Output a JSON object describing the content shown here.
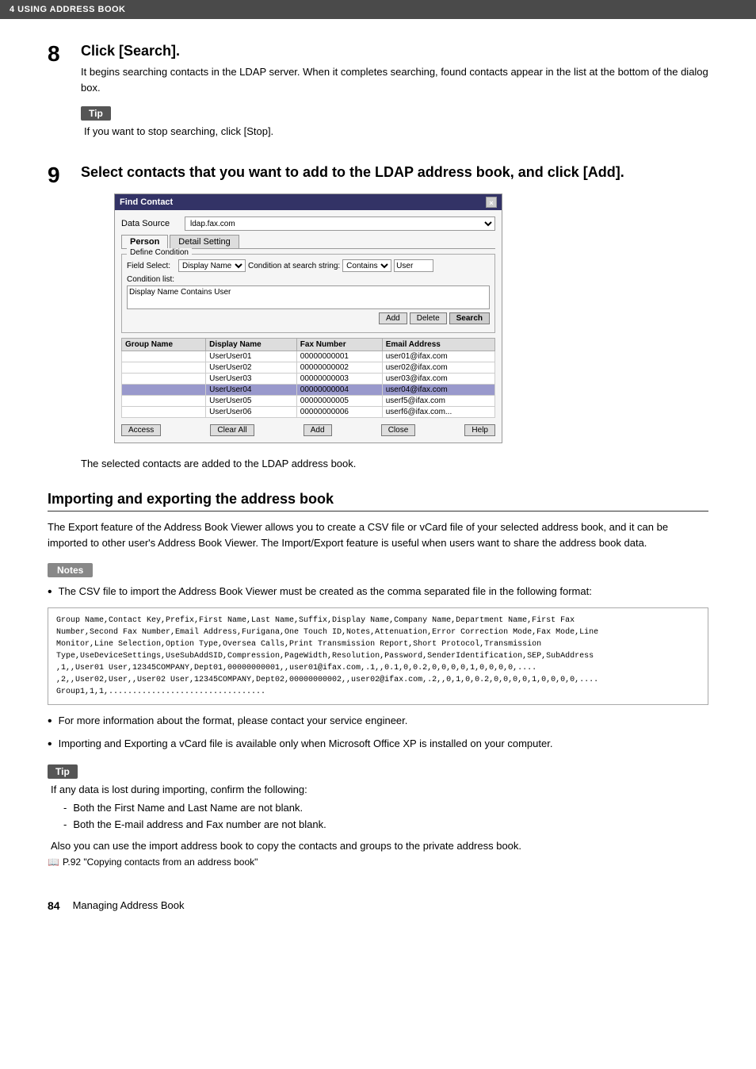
{
  "header": {
    "text": "4   USING ADDRESS BOOK"
  },
  "step8": {
    "number": "8",
    "title": "Click [Search].",
    "description": "It begins searching contacts in the LDAP server. When it completes searching, found contacts appear in the list at the bottom of the dialog box."
  },
  "tip1": {
    "label": "Tip",
    "text": "If you want to stop searching, click [Stop]."
  },
  "step9": {
    "number": "9",
    "title": "Select contacts that you want to add to the LDAP address book, and click [Add]."
  },
  "dialog": {
    "title": "Find Contact",
    "close": "×",
    "data_source_label": "Data Source",
    "data_source_value": "ldap.fax.com",
    "tabs": [
      "Person",
      "Detail Setting"
    ],
    "define_condition_title": "Define Condition",
    "field_select_label": "Field Select:",
    "field_select_value": "Display Name",
    "condition_label": "Condition at search string:",
    "condition_value": "Contains",
    "search_value": "User",
    "condition_list_label": "Condition list:",
    "condition_list_value": "Display Name Contains User",
    "buttons": {
      "add": "Add",
      "delete": "Delete",
      "search": "Search"
    },
    "table": {
      "headers": [
        "Group Name",
        "Display Name",
        "Fax Number",
        "Email Address"
      ],
      "rows": [
        [
          "",
          "UserUser01",
          "00000000001",
          "user01@ifax.com"
        ],
        [
          "",
          "UserUser02",
          "00000000002",
          "user02@ifax.com"
        ],
        [
          "",
          "UserUser03",
          "00000000003",
          "user03@ifax.com"
        ],
        [
          "",
          "UserUser04",
          "00000000004",
          "user04@ifax.com"
        ],
        [
          "",
          "UserUser05",
          "00000000005",
          "userf5@ifax.com"
        ],
        [
          "",
          "UserUser06",
          "00000000006",
          "userf6@ifax.com..."
        ]
      ]
    },
    "footer_buttons": {
      "access": "Access",
      "clear_all": "Clear All",
      "add": "Add",
      "close": "Close",
      "help": "Help"
    }
  },
  "step9_result": "The selected contacts are added to the LDAP address book.",
  "import_export_section": {
    "title": "Importing and exporting the address book",
    "body": "The Export feature of the Address Book Viewer allows you to create a CSV file or vCard file of your selected address book, and it can be imported to other user's Address Book Viewer. The Import/Export feature is useful when users want to share the address book data."
  },
  "notes": {
    "label": "Notes",
    "items": [
      "The CSV file to import the Address Book Viewer must be created as the comma separated file in the following format:",
      "For more information about the format, please contact your service engineer.",
      "Importing and Exporting a vCard file is available only when Microsoft Office XP is installed on your computer."
    ]
  },
  "code_block": "Group Name,Contact Key,Prefix,First Name,Last Name,Suffix,Display Name,Company Name,Department Name,First Fax\nNumber,Second Fax Number,Email Address,Furigana,One Touch ID,Notes,Attenuation,Error Correction Mode,Fax Mode,Line\nMonitor,Line Selection,Option Type,Oversea Calls,Print Transmission Report,Short Protocol,Transmission\nType,UseDeviceSettings,UseSubAddSID,Compression,PageWidth,Resolution,Password,SenderIdentification,SEP,SubAddress\n,1,,User01 User,12345COMPANY,Dept01,00000000001,,user01@ifax.com,.1,,0.1,0,0.2,0,0,0,0,1,0,0,0,0,....\n,2,,User02,User,,User02 User,12345COMPANY,Dept02,00000000002,,user02@ifax.com,.2,,0,1,0,0.2,0,0,0,0,1,0,0,0,0,....\nGroup1,1,1,.................................",
  "tip2": {
    "label": "Tip",
    "intro": "If any data is lost during importing, confirm the following:",
    "items": [
      "Both the First Name and Last Name are not blank.",
      "Both the E-mail address and Fax number are not blank."
    ],
    "extra": "Also you can use the import address book to copy the contacts and groups to the private address book.",
    "ref": "P.92 \"Copying contacts from an address book\""
  },
  "footer": {
    "page_number": "84",
    "page_label": "Managing Address Book"
  }
}
